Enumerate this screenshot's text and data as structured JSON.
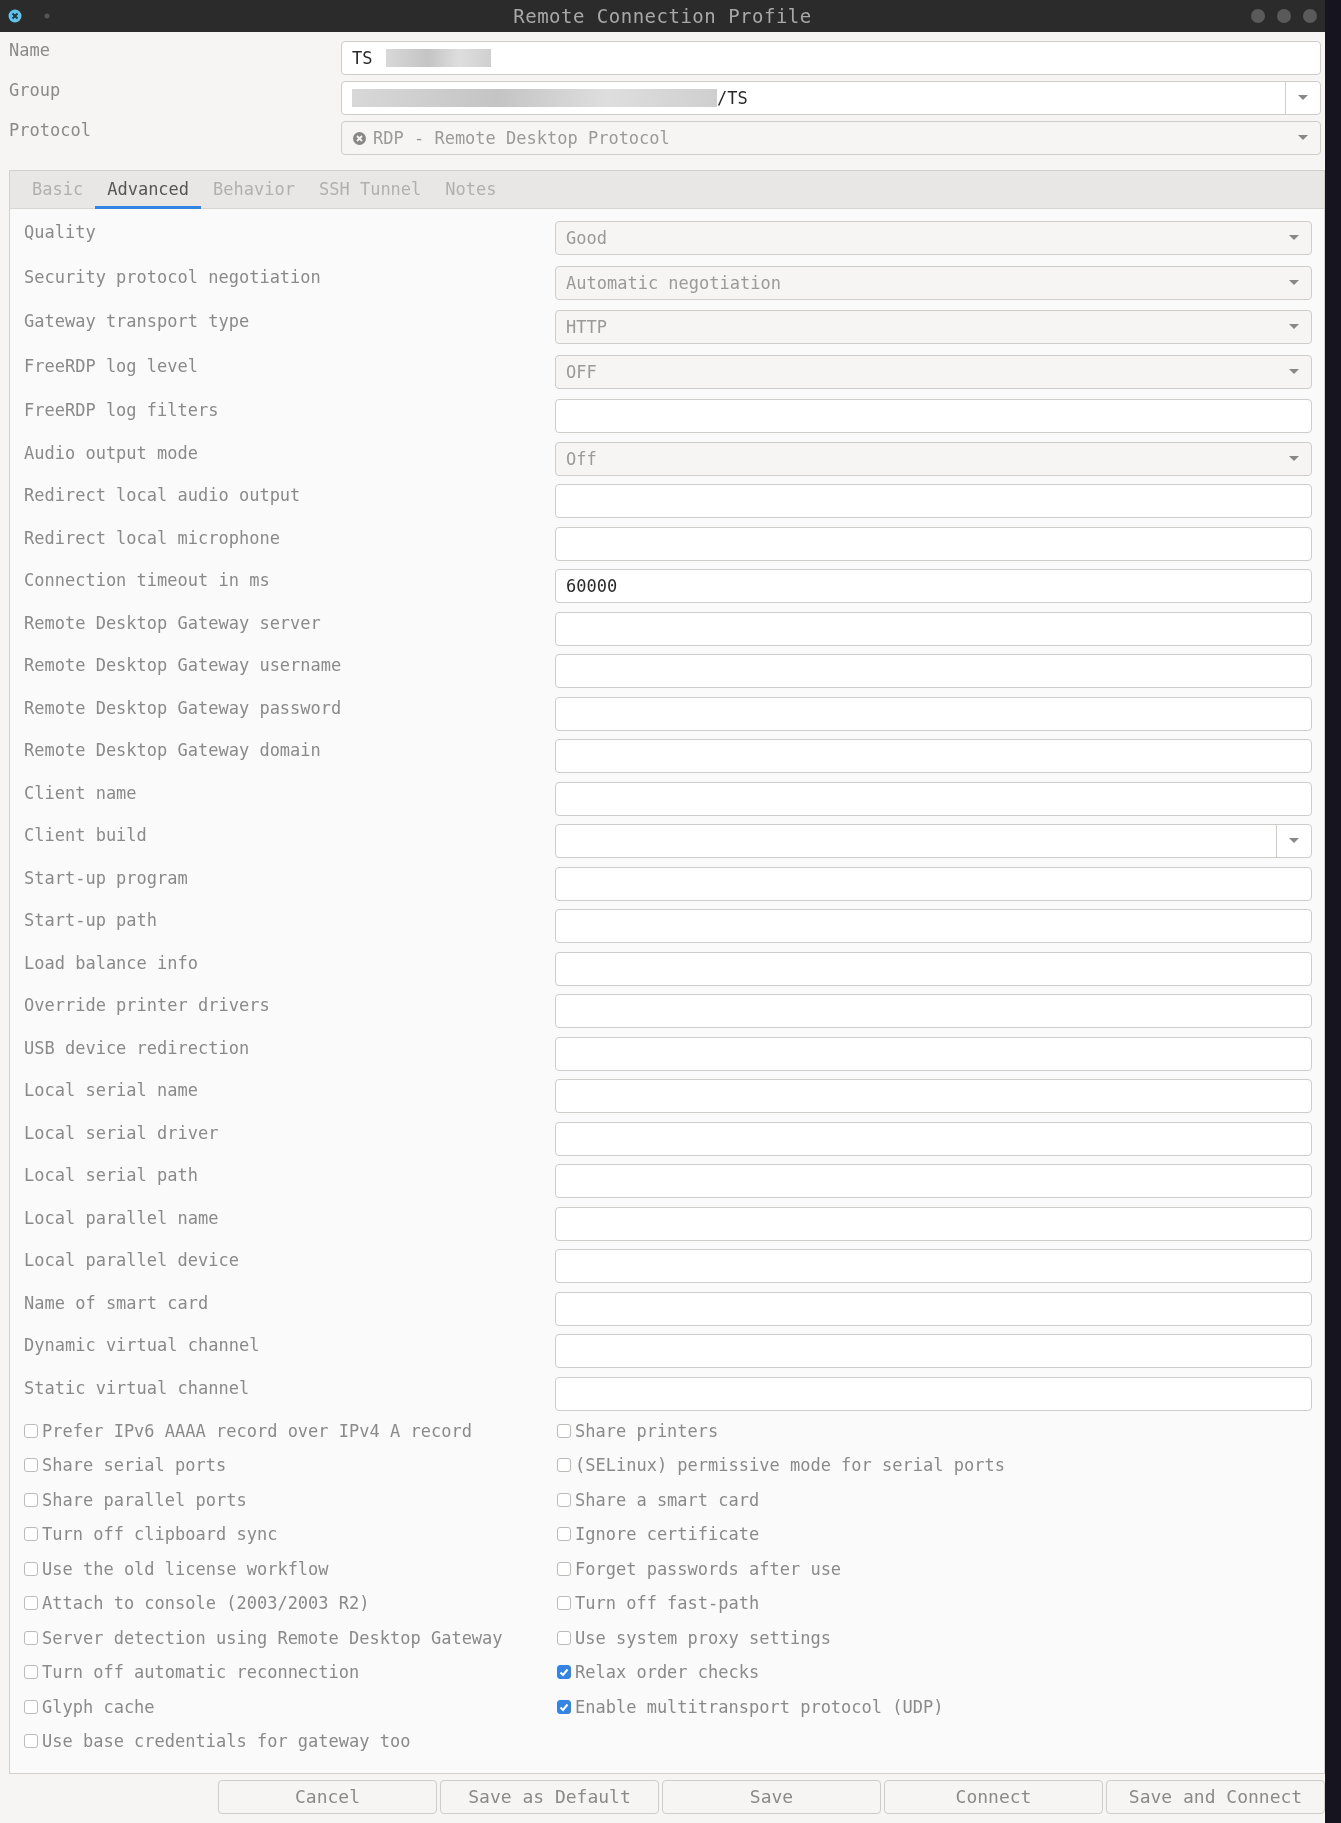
{
  "window": {
    "title": "Remote Connection Profile"
  },
  "header_fields": [
    {
      "label": "Name",
      "kind": "entry",
      "value": "TS",
      "blurred_suffix": true
    },
    {
      "label": "Group",
      "kind": "combo-entry",
      "value": "/TS",
      "blurred_prefix": true
    },
    {
      "label": "Protocol",
      "kind": "combo",
      "value": "RDP - Remote Desktop Protocol"
    }
  ],
  "tabs": [
    {
      "label": "Basic",
      "selected": false
    },
    {
      "label": "Advanced",
      "selected": true
    },
    {
      "label": "Behavior",
      "selected": false
    },
    {
      "label": "SSH Tunnel",
      "selected": false
    },
    {
      "label": "Notes",
      "selected": false
    }
  ],
  "fields": [
    {
      "label": "Quality",
      "kind": "combo",
      "value": "Good"
    },
    {
      "label": "Security protocol negotiation",
      "kind": "combo",
      "value": "Automatic negotiation"
    },
    {
      "label": "Gateway transport type",
      "kind": "combo",
      "value": "HTTP"
    },
    {
      "label": "FreeRDP log level",
      "kind": "combo",
      "value": "OFF"
    },
    {
      "label": "FreeRDP log filters",
      "kind": "entry"
    },
    {
      "label": "Audio output mode",
      "kind": "combo",
      "value": "Off"
    },
    {
      "label": "Redirect local audio output",
      "kind": "entry"
    },
    {
      "label": "Redirect local microphone",
      "kind": "entry"
    },
    {
      "label": "Connection timeout in ms",
      "kind": "entry",
      "value": "60000"
    },
    {
      "label": "Remote Desktop Gateway server",
      "kind": "entry"
    },
    {
      "label": "Remote Desktop Gateway username",
      "kind": "entry"
    },
    {
      "label": "Remote Desktop Gateway password",
      "kind": "entry"
    },
    {
      "label": "Remote Desktop Gateway domain",
      "kind": "entry"
    },
    {
      "label": "Client name",
      "kind": "entry"
    },
    {
      "label": "Client build",
      "kind": "combo-entry"
    },
    {
      "label": "Start-up program",
      "kind": "entry"
    },
    {
      "label": "Start-up path",
      "kind": "entry"
    },
    {
      "label": "Load balance info",
      "kind": "entry"
    },
    {
      "label": "Override printer drivers",
      "kind": "entry"
    },
    {
      "label": "USB device redirection",
      "kind": "entry"
    },
    {
      "label": "Local serial name",
      "kind": "entry"
    },
    {
      "label": "Local serial driver",
      "kind": "entry"
    },
    {
      "label": "Local serial path",
      "kind": "entry"
    },
    {
      "label": "Local parallel name",
      "kind": "entry"
    },
    {
      "label": "Local parallel device",
      "kind": "entry"
    },
    {
      "label": "Name of smart card",
      "kind": "entry"
    },
    {
      "label": "Dynamic virtual channel",
      "kind": "entry"
    },
    {
      "label": "Static virtual channel",
      "kind": "entry"
    }
  ],
  "options_left": [
    {
      "label": "Prefer IPv6 AAAA record over IPv4 A record",
      "checked": false
    },
    {
      "label": "Share serial ports",
      "checked": false
    },
    {
      "label": "Share parallel ports",
      "checked": false
    },
    {
      "label": "Turn off clipboard sync",
      "checked": false
    },
    {
      "label": "Use the old license workflow",
      "checked": false
    },
    {
      "label": "Attach to console (2003/2003 R2)",
      "checked": false
    },
    {
      "label": "Server detection using Remote Desktop Gateway",
      "checked": false
    },
    {
      "label": "Turn off automatic reconnection",
      "checked": false
    },
    {
      "label": "Glyph cache",
      "checked": false
    },
    {
      "label": "Use base credentials for gateway too",
      "checked": false
    }
  ],
  "options_right": [
    {
      "label": "Share printers",
      "checked": false
    },
    {
      "label": "(SELinux) permissive mode for serial ports",
      "checked": false
    },
    {
      "label": "Share a smart card",
      "checked": false
    },
    {
      "label": "Ignore certificate",
      "checked": false
    },
    {
      "label": "Forget passwords after use",
      "checked": false
    },
    {
      "label": "Turn off fast-path",
      "checked": false
    },
    {
      "label": "Use system proxy settings",
      "checked": false
    },
    {
      "label": "Relax order checks",
      "checked": true
    },
    {
      "label": "Enable multitransport protocol (UDP)",
      "checked": true
    }
  ],
  "buttons": [
    "Cancel",
    "Save as Default",
    "Save",
    "Connect",
    "Save and Connect"
  ]
}
